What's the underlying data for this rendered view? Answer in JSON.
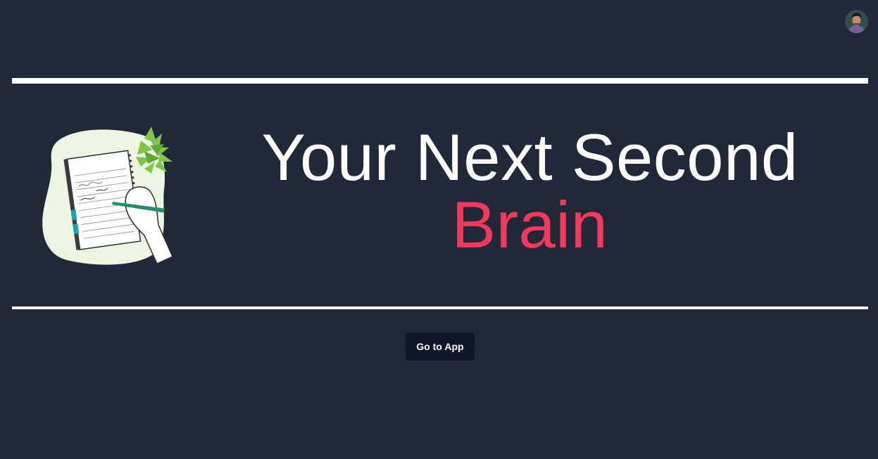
{
  "hero": {
    "headline_line1": "Your Next Second",
    "headline_line2": "Brain"
  },
  "cta": {
    "label": "Go to App"
  },
  "colors": {
    "background": "#212938",
    "accent": "#f1395e",
    "button": "#0f1728",
    "rule": "#ffffff"
  },
  "icons": {
    "avatar": "user-avatar",
    "illustration": "notebook-writing-illustration"
  }
}
